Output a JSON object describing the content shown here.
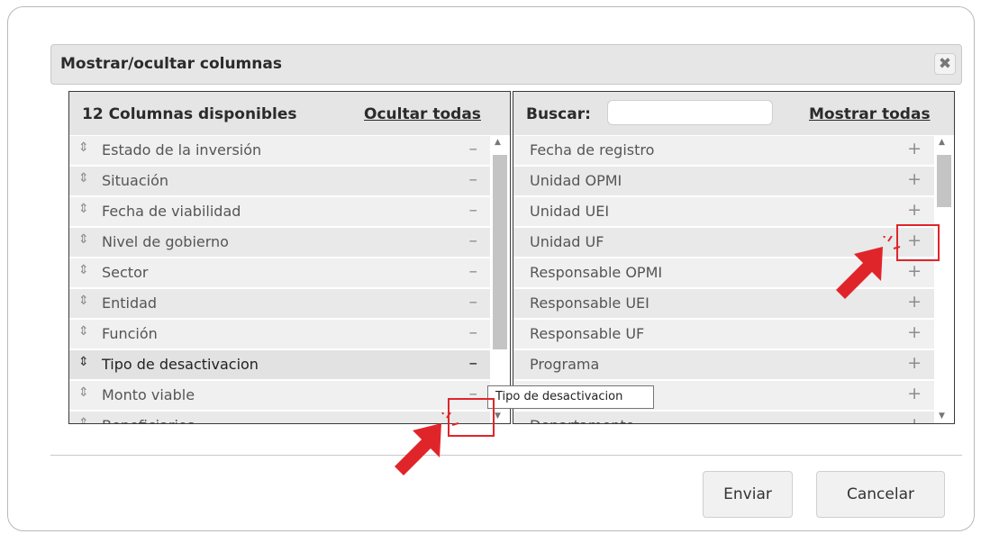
{
  "dialog": {
    "title": "Mostrar/ocultar columnas",
    "close_icon": "close-icon",
    "tooltip": "Tipo de desactivacion",
    "buttons": {
      "submit": "Enviar",
      "cancel": "Cancelar"
    }
  },
  "left_panel": {
    "header": "12 Columnas disponibles",
    "hide_all": "Ocultar todas",
    "scroll_fraction": 0.0,
    "items": [
      {
        "label": "Estado de la inversión",
        "action": "–"
      },
      {
        "label": "Situación",
        "action": "–"
      },
      {
        "label": "Fecha de viabilidad",
        "action": "–"
      },
      {
        "label": "Nivel de gobierno",
        "action": "–"
      },
      {
        "label": "Sector",
        "action": "–"
      },
      {
        "label": "Entidad",
        "action": "–"
      },
      {
        "label": "Función",
        "action": "–"
      },
      {
        "label": "Tipo de desactivacion",
        "action": "–"
      },
      {
        "label": "Monto viable",
        "action": "–"
      },
      {
        "label": "Beneficiarios",
        "action": "–"
      }
    ],
    "grip_icon": "drag-handle-icon"
  },
  "right_panel": {
    "search_label": "Buscar:",
    "search_value": "",
    "show_all": "Mostrar todas",
    "items": [
      {
        "label": "Fecha de registro",
        "action": "+"
      },
      {
        "label": "Unidad OPMI",
        "action": "+"
      },
      {
        "label": "Unidad UEI",
        "action": "+"
      },
      {
        "label": "Unidad UF",
        "action": "+"
      },
      {
        "label": "Responsable OPMI",
        "action": "+"
      },
      {
        "label": "Responsable UEI",
        "action": "+"
      },
      {
        "label": "Responsable UF",
        "action": "+"
      },
      {
        "label": "Programa",
        "action": "+"
      },
      {
        "label": "",
        "action": "+"
      },
      {
        "label": "Departamento",
        "action": "+"
      }
    ]
  },
  "annotations": {
    "highlight_color": "#e0252a",
    "arrow_icon": "red-cursor-arrow-icon"
  }
}
